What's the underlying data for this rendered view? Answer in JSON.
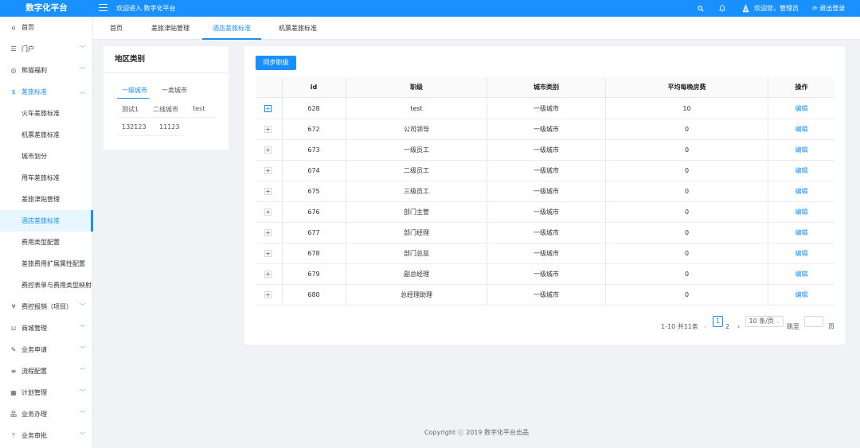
{
  "app": {
    "title": "数字化平台",
    "welcome": "欢迎进入 数字化平台"
  },
  "header": {
    "greeting": "欢迎您，管理员",
    "logout": "退出登录",
    "icons": [
      "search-icon",
      "bell-icon",
      "avatar"
    ]
  },
  "sidebar": {
    "items": [
      {
        "label": "首页",
        "icon": "home-icon",
        "expandable": false
      },
      {
        "label": "门户",
        "icon": "portal-icon",
        "expandable": true
      },
      {
        "label": "熊猫福利",
        "icon": "gift-icon",
        "expandable": true
      },
      {
        "label": "差旅标准",
        "icon": "dollar-icon",
        "expandable": true,
        "open": true
      },
      {
        "label": "火车差旅标准",
        "sub": true
      },
      {
        "label": "机票差旅标准",
        "sub": true
      },
      {
        "label": "城市划分",
        "sub": true
      },
      {
        "label": "用车差旅标准",
        "sub": true
      },
      {
        "label": "差旅津贴管理",
        "sub": true
      },
      {
        "label": "酒店差旅标准",
        "sub": true,
        "active": true
      },
      {
        "label": "费用类型配置",
        "sub": true
      },
      {
        "label": "差旅费用扩展属性配置",
        "sub": true
      },
      {
        "label": "费控表单与费用类型映射",
        "sub": true
      },
      {
        "label": "费控报销（项目）",
        "icon": "yen-icon",
        "expandable": true
      },
      {
        "label": "商城管理",
        "icon": "cart-icon",
        "expandable": true
      },
      {
        "label": "业务申请",
        "icon": "edit-icon",
        "expandable": true
      },
      {
        "label": "流程配置",
        "icon": "list-icon",
        "expandable": true
      },
      {
        "label": "计划管理",
        "icon": "calendar-icon",
        "expandable": true
      },
      {
        "label": "业务办理",
        "icon": "org-icon",
        "expandable": true
      },
      {
        "label": "业务审批",
        "icon": "branch-icon",
        "expandable": true
      }
    ]
  },
  "tabs": [
    {
      "label": "首页"
    },
    {
      "label": "差旅津贴管理"
    },
    {
      "label": "酒店差旅标准",
      "active": true
    },
    {
      "label": "机票差旅标准"
    }
  ],
  "region_card": {
    "title": "地区类别",
    "tabs": [
      "一级城市",
      "一类城市"
    ],
    "rows": [
      [
        "测试1",
        "二线城市",
        "test"
      ],
      [
        "132123",
        "11123"
      ]
    ]
  },
  "main": {
    "sync_button": "同步职级",
    "columns": [
      "id",
      "职级",
      "城市类别",
      "平均每晚房费",
      "操作"
    ],
    "rows": [
      {
        "id": "628",
        "level": "test",
        "city": "一级城市",
        "fee": "10",
        "action": "编辑"
      },
      {
        "id": "672",
        "level": "公司领导",
        "city": "一级城市",
        "fee": "0",
        "action": "编辑"
      },
      {
        "id": "673",
        "level": "一级员工",
        "city": "一级城市",
        "fee": "0",
        "action": "编辑"
      },
      {
        "id": "674",
        "level": "二级员工",
        "city": "一级城市",
        "fee": "0",
        "action": "编辑"
      },
      {
        "id": "675",
        "level": "三级员工",
        "city": "一级城市",
        "fee": "0",
        "action": "编辑"
      },
      {
        "id": "676",
        "level": "部门主管",
        "city": "一级城市",
        "fee": "0",
        "action": "编辑"
      },
      {
        "id": "677",
        "level": "部门经理",
        "city": "一级城市",
        "fee": "0",
        "action": "编辑"
      },
      {
        "id": "678",
        "level": "部门总监",
        "city": "一级城市",
        "fee": "0",
        "action": "编辑"
      },
      {
        "id": "679",
        "level": "副总经理",
        "city": "一级城市",
        "fee": "0",
        "action": "编辑"
      },
      {
        "id": "680",
        "level": "总经理助理",
        "city": "一级城市",
        "fee": "0",
        "action": "编辑"
      }
    ],
    "pagination": {
      "summary": "1-10 共11条",
      "pages": [
        "1",
        "2"
      ],
      "current": "1",
      "page_size": "10 条/页",
      "jump_label": "跳至",
      "page_unit": "页"
    }
  },
  "footer": {
    "text": "Copyright ⓒ 2019 数字化平台出品"
  },
  "colors": {
    "primary": "#1890ff",
    "background": "#f0f2f5"
  }
}
